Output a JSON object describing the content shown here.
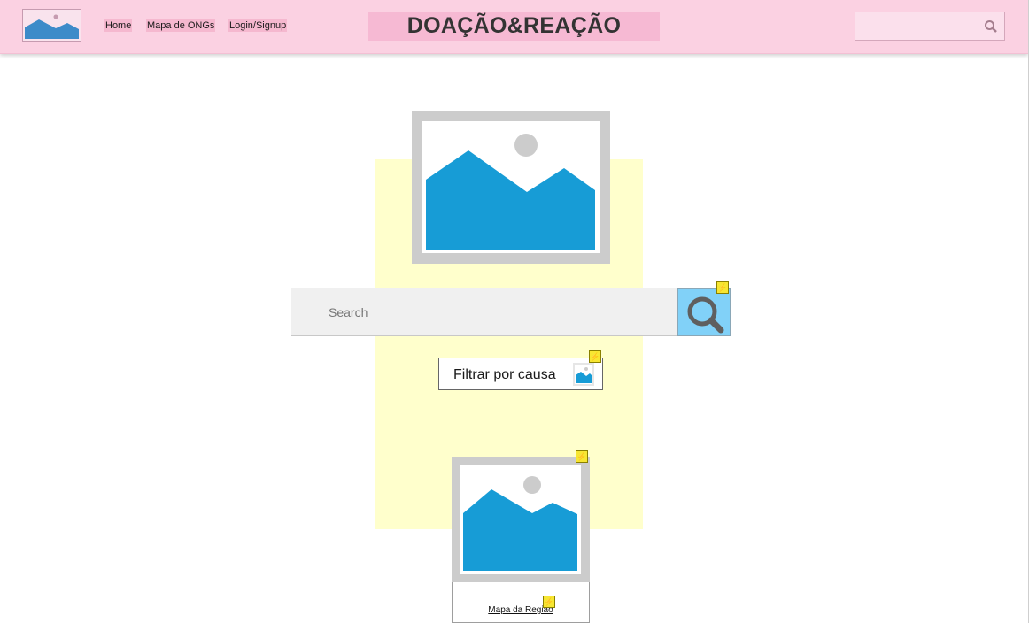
{
  "header": {
    "logo_icon": "image-placeholder-icon",
    "nav": [
      "Home",
      "Mapa de ONGs",
      "Login/Signup"
    ],
    "title": "DOAÇÃO&REAÇÃO",
    "search_icon": "search-icon"
  },
  "main": {
    "hero_icon": "image-placeholder-icon",
    "search": {
      "placeholder": "Search",
      "button_icon": "search-icon"
    },
    "filter": {
      "label": "Filtrar por causa",
      "icon": "image-placeholder-icon"
    },
    "map_card": {
      "caption": "Mapa da Região",
      "icon": "image-placeholder-icon"
    },
    "badge_icon": "lightning-icon"
  },
  "colors": {
    "header_bg": "#fbd1e2",
    "title_bg": "#f6b9d3",
    "panel_bg": "#ffffcc",
    "search_button_bg": "#81d1f8",
    "image_blue": "#179cd6",
    "badge_yellow": "#f7e632"
  }
}
